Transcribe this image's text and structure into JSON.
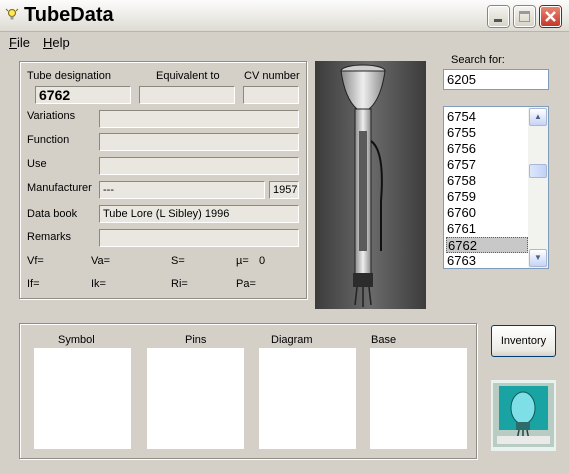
{
  "window": {
    "title": "TubeData"
  },
  "menu": {
    "file": "File",
    "help": "Help"
  },
  "details": {
    "designation_label": "Tube designation",
    "equivalent_label": "Equivalent to",
    "cv_label": "CV number",
    "designation_value": "6762",
    "equivalent_value": "",
    "cv_value": "",
    "variations_label": "Variations",
    "function_label": "Function",
    "use_label": "Use",
    "manufacturer_label": "Manufacturer",
    "manufacturer_value": "---",
    "year_value": "1957",
    "databook_label": "Data book",
    "databook_value": "Tube Lore (L Sibley) 1996",
    "remarks_label": "Remarks",
    "params": {
      "vf": "Vf=",
      "va": "Va=",
      "s": "S=",
      "mu": "µ=",
      "mu_value": "0",
      "if": "If=",
      "ik": "Ik=",
      "ri": "Ri=",
      "pa": "Pa="
    }
  },
  "search": {
    "label": "Search for:",
    "value": "6205",
    "items": [
      "6754",
      "6755",
      "6756",
      "6757",
      "6758",
      "6759",
      "6760",
      "6761",
      "6762",
      "6763"
    ],
    "selected": "6762"
  },
  "panels": {
    "symbol": "Symbol",
    "pins": "Pins",
    "diagram": "Diagram",
    "base": "Base"
  },
  "buttons": {
    "inventory": "Inventory"
  },
  "colors": {
    "close_button": "#c2382b",
    "selection": "#c8c8c8",
    "logo_bg": "#1aa3a3"
  }
}
